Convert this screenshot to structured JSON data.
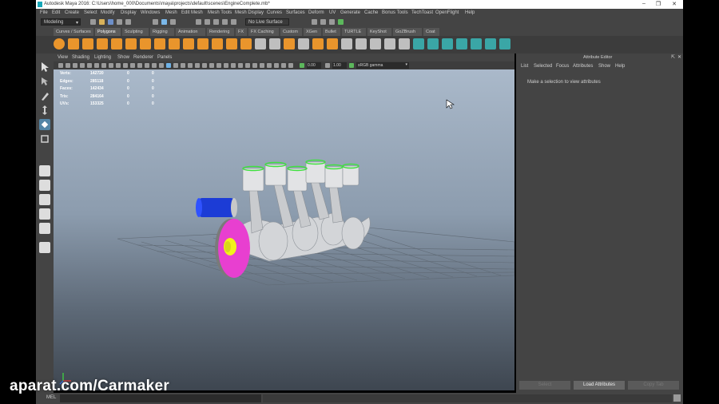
{
  "window": {
    "title": "Autodesk Maya 2016: C:\\Users\\home_000\\Documents\\maya\\projects\\default\\scenes\\EngineComplete.mb*"
  },
  "menubar": {
    "items": [
      "File",
      "Edit",
      "Create",
      "Select",
      "Modify",
      "Display",
      "Windows",
      "Mesh",
      "Edit Mesh",
      "Mesh Tools",
      "Mesh Display",
      "Curves",
      "Surfaces",
      "Deform",
      "UV",
      "Generate",
      "Cache",
      "Bonus Tools",
      "TechToast",
      "OpenFlight",
      "Help"
    ]
  },
  "statusline": {
    "menuset": "Modeling",
    "symmetry": "No Live Surface"
  },
  "shelf": {
    "tabs": [
      "Curves / Surfaces",
      "Polygons",
      "Sculpting",
      "Rigging",
      "Animation",
      "Rendering",
      "FX",
      "FX Caching",
      "Custom",
      "XGen",
      "Bullet",
      "TURTLE",
      "KeyShot",
      "GoZBrush",
      "Coat"
    ],
    "active_tab": "Polygons"
  },
  "viewport": {
    "menu": [
      "View",
      "Shading",
      "Lighting",
      "Show",
      "Renderer",
      "Panels"
    ],
    "exposure": "0.00",
    "gamma": "1.00",
    "colorspace": "sRGB gamma",
    "hud": [
      {
        "label": "Verts:",
        "v1": "142720",
        "v2": "0",
        "v3": "0"
      },
      {
        "label": "Edges:",
        "v1": "285118",
        "v2": "0",
        "v3": "0"
      },
      {
        "label": "Faces:",
        "v1": "142434",
        "v2": "0",
        "v3": "0"
      },
      {
        "label": "Tris:",
        "v1": "284164",
        "v2": "0",
        "v3": "0"
      },
      {
        "label": "UVs:",
        "v1": "153325",
        "v2": "0",
        "v3": "0"
      }
    ]
  },
  "attribute_editor": {
    "title": "Attribute Editor",
    "menu": [
      "List",
      "Selected",
      "Focus",
      "Attributes",
      "Show",
      "Help"
    ],
    "message": "Make a selection to view attributes",
    "buttons": {
      "select": "Select",
      "load": "Load Attributes",
      "copy": "Copy Tab"
    }
  },
  "cmdline": {
    "label": "MEL"
  },
  "watermark": "aparat.com/Carmaker",
  "colors": {
    "accent_green": "#3fe03f",
    "magenta": "#e83fd0",
    "blue": "#1c3cd6",
    "yellow": "#f2f21a"
  }
}
